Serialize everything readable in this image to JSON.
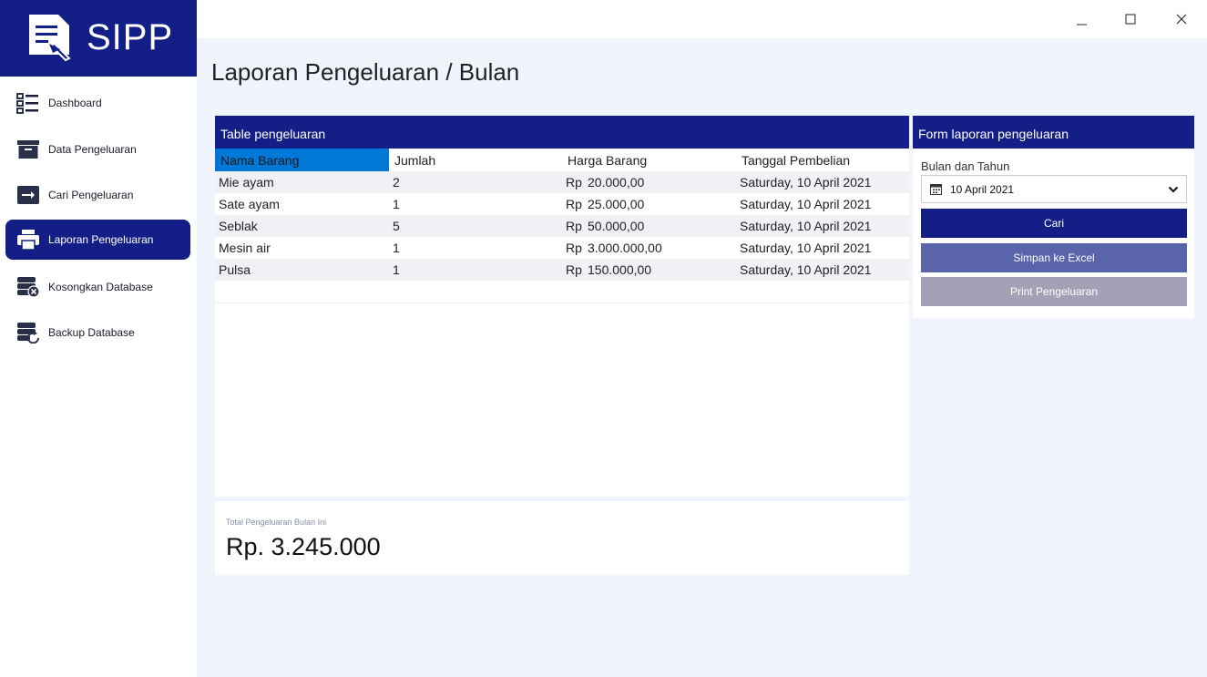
{
  "app": {
    "name": "SIPP"
  },
  "sidebar": {
    "items": [
      {
        "label": "Dashboard",
        "icon": "list-icon"
      },
      {
        "label": "Data Pengeluaran",
        "icon": "archive-box-icon"
      },
      {
        "label": "Cari Pengeluaran",
        "icon": "arrow-right-icon"
      },
      {
        "label": "Laporan Pengeluaran",
        "icon": "printer-icon",
        "active": true
      },
      {
        "label": "Kosongkan Database",
        "icon": "database-delete-icon"
      },
      {
        "label": "Backup Database",
        "icon": "database-refresh-icon"
      }
    ]
  },
  "page": {
    "title": "Laporan Pengeluaran / Bulan"
  },
  "table": {
    "title": "Table pengeluaran",
    "columns": [
      "Nama Barang",
      "Jumlah",
      "Harga Barang",
      "Tanggal Pembelian"
    ],
    "rows": [
      {
        "nama": "Mie ayam",
        "jumlah": "2",
        "rp": "Rp",
        "harga": "20.000,00",
        "tanggal": "Saturday, 10 April 2021"
      },
      {
        "nama": "Sate ayam",
        "jumlah": "1",
        "rp": "Rp",
        "harga": "25.000,00",
        "tanggal": "Saturday, 10 April 2021"
      },
      {
        "nama": "Seblak",
        "jumlah": "5",
        "rp": "Rp",
        "harga": "50.000,00",
        "tanggal": "Saturday, 10 April 2021"
      },
      {
        "nama": "Mesin air",
        "jumlah": "1",
        "rp": "Rp",
        "harga": "3.000.000,00",
        "tanggal": "Saturday, 10 April 2021"
      },
      {
        "nama": "Pulsa",
        "jumlah": "1",
        "rp": "Rp",
        "harga": "150.000,00",
        "tanggal": "Saturday, 10 April 2021"
      }
    ]
  },
  "total": {
    "label": "Total Pengeluaran Bulan Ini",
    "value": "Rp. 3.245.000"
  },
  "form": {
    "title": "Form laporan pengeluaran",
    "date_label": "Bulan dan Tahun",
    "date_value": "10 April 2021",
    "btn_cari": "Cari",
    "btn_excel": "Simpan ke Excel",
    "btn_print": "Print Pengeluaran"
  },
  "colors": {
    "primary": "#131f86",
    "accent": "#0078d7",
    "excel": "#5a64ab",
    "print": "#a3a1b6",
    "background": "#f0f4fc"
  }
}
